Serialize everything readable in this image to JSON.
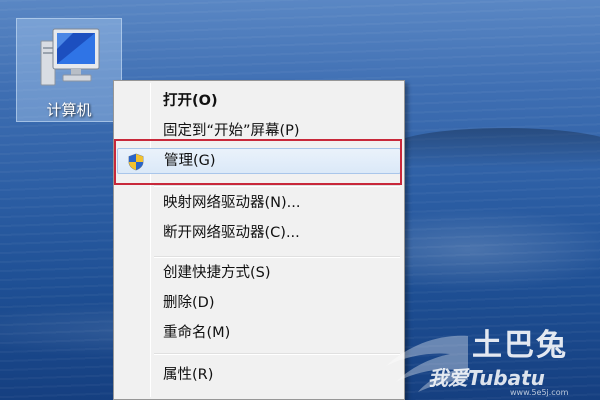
{
  "desktop": {
    "icon": {
      "label": "计算机",
      "icon_name": "computer-icon"
    }
  },
  "context_menu": {
    "items": [
      {
        "label": "打开(O)",
        "bold": true
      },
      {
        "label": "固定到“开始”屏幕(P)"
      },
      {
        "label": "管理(G)",
        "icon_name": "uac-shield-icon",
        "highlighted": true
      },
      {
        "label": "映射网络驱动器(N)..."
      },
      {
        "label": "断开网络驱动器(C)..."
      },
      {
        "label": "创建快捷方式(S)"
      },
      {
        "label": "删除(D)"
      },
      {
        "label": "重命名(M)"
      },
      {
        "label": "属性(R)"
      }
    ]
  },
  "watermark": {
    "title": "土巴兔",
    "subtitle": "我爱Tubatu",
    "url": "www.5e5j.com"
  },
  "colors": {
    "highlight_border": "#c8283a",
    "menu_background": "#f1f1f1",
    "selection": "#dbe9f8"
  }
}
